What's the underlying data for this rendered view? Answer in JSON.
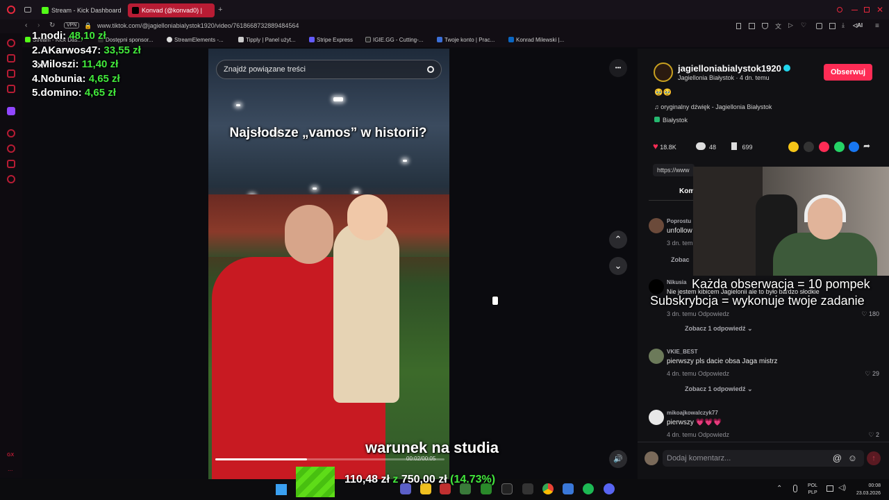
{
  "browser": {
    "tabs": [
      {
        "label": "Stream - Kick Dashboard",
        "color": "#53fc18"
      },
      {
        "label": "Konvad (@konvad0) |",
        "color": "#b81c34"
      }
    ],
    "new_tab_label": "+",
    "vpn_label": "VPN",
    "url": "www.tiktok.com/@jagielloniabialystok1920/video/7618668732889484564",
    "ai_label": "AI",
    "bookmarks": [
      "Stream - Kick Das...",
      "Dostępni sponsor...",
      "StreamElements -...",
      "Tipply | Panel użyt...",
      "Stripe Express",
      "IGIE.GG - Cutting-...",
      "Twoje konto | Prac...",
      "Konrad Milewski |..."
    ]
  },
  "sidebar": {
    "bottom_label": "GX",
    "more_label": "..."
  },
  "leaderboard": [
    {
      "rank": "1.",
      "name": "nodi:",
      "amount": "48,10 zł"
    },
    {
      "rank": "2.",
      "name": "AKarwos47:",
      "amount": "33,55 zł"
    },
    {
      "rank": "3.",
      "name": "Miloszi:",
      "amount": "11,40 zł"
    },
    {
      "rank": "4.",
      "name": "Nobunia:",
      "amount": "4,65 zł"
    },
    {
      "rank": "5.",
      "name": "domino:",
      "amount": "4,65 zł"
    }
  ],
  "video": {
    "search_placeholder": "Znajdź powiązane treści",
    "caption": "Najsłodsze „vamos” w historii?",
    "subtitle": "warunek na studia",
    "timecode": "00:02/00:05",
    "progress": 0.4,
    "more_label": "•••",
    "up_label": "⌃",
    "down_label": "⌄",
    "volume_label": "🔊"
  },
  "creator": {
    "username": "jagielloniabialystok1920",
    "meta": "Jagiellonia Białystok · 4 dn. temu",
    "follow_label": "Obserwuj",
    "emoji_line": "🥹🥹",
    "sound": "oryginalny dźwięk - Jagiellonia Białystok",
    "location": "Białystok",
    "likes": "18.8K",
    "comments": "48",
    "saves": "699",
    "link_partial": "https://www",
    "tab_partial": "Kom"
  },
  "comments": [
    {
      "name": "Poprostu",
      "text": "unfollow",
      "meta": "3 dn. temu",
      "like": "",
      "more": "Zobac",
      "color": "#6b4a3a"
    },
    {
      "name": "Nikusia",
      "text": "Nie jestem kibicem Jagielonii ale to było bardzo słodkie",
      "meta": "3 dn. temu   Odpowiedz",
      "like": "♡ 180",
      "more": "Zobacz 1 odpowiedź ⌄",
      "color": "#111"
    },
    {
      "name": "VKIE_BEST",
      "text": "pierwszy pls dacie obsa Jaga mistrz",
      "meta": "4 dn. temu   Odpowiedz",
      "like": "♡ 29",
      "more": "Zobacz 1 odpowiedź ⌄",
      "color": "#6c7a5a"
    },
    {
      "name": "mikoajkowalczyk77",
      "text": "pierwszy 💗💗💗",
      "meta": "4 dn. temu   Odpowiedz",
      "like": "♡ 2",
      "more": "",
      "color": "#e8e8e8"
    }
  ],
  "comment_input_placeholder": "Dodaj komentarz...",
  "webcam_overlay": {
    "line1": "Każda obserwacja = 10 pompek",
    "line2": "Subskrybcja = wykonuje twoje zadanie"
  },
  "goal": {
    "current": "110,48 zł",
    "sep": "z",
    "target": "750,00 zł",
    "percent": "(14.73%)",
    "fraction": 0.1473
  },
  "taskbar": {
    "lang_top": "POL",
    "lang_bottom": "PLP",
    "time": "00:08",
    "date": "23.03.2026"
  },
  "colors": {
    "accent": "#fe2c55",
    "kick": "#53fc18",
    "opera": "#b81c34",
    "verified": "#20d5ec"
  }
}
